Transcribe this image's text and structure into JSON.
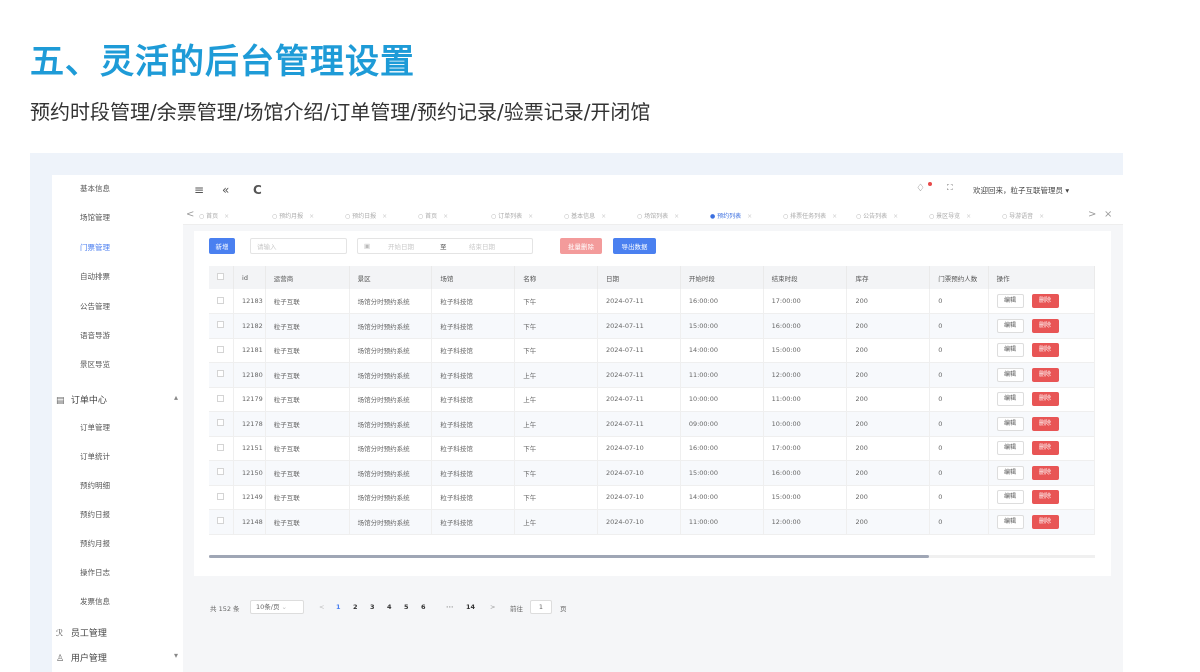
{
  "heading": {
    "title": "五、灵活的后台管理设置",
    "subtitle": "预约时段管理/余票管理/场馆介绍/订单管理/预约记录/验票记录/开闭馆"
  },
  "colors": {
    "accent": "#1e9bd7",
    "primary": "#4a80f0",
    "danger": "#e85555",
    "frame_bg": "#eef3fa"
  },
  "sidebar": {
    "items": [
      "基本信息",
      "场馆管理",
      "门票管理",
      "自动排票",
      "公告管理",
      "语音导游",
      "景区导览"
    ],
    "active_item": "门票管理",
    "order_center": {
      "icon": "order-icon",
      "label": "订单中心",
      "arrow": "▴"
    },
    "order_items": [
      "订单管理",
      "订单统计",
      "预约明细",
      "预约日报",
      "预约月报",
      "操作日志",
      "发票信息"
    ],
    "staff": {
      "icon": "staff-icon",
      "label": "员工管理"
    },
    "users": {
      "icon": "user-icon",
      "label": "用户管理",
      "arrow": "▾"
    }
  },
  "topbar": {
    "menu_icon": "≡",
    "collapse_icon": "«",
    "refresh_icon": "C",
    "bell_icon": "bell-icon",
    "fullscreen_icon": "fullscreen-icon",
    "welcome": "欢迎回来，粒子互联管理员 ▾"
  },
  "tabs": {
    "prev": "<",
    "next": ">",
    "close": "×",
    "items": [
      "首页",
      "预约月报",
      "预约日报",
      "首页",
      "订单列表",
      "基本信息",
      "场馆列表",
      "预约列表",
      "排票任务列表",
      "公告列表",
      "景区导览",
      "导游语音"
    ],
    "active_index": 7
  },
  "toolbar": {
    "add_label": "新增",
    "search_placeholder": "请输入",
    "date_icon": "calendar-icon",
    "start_date_placeholder": "开始日期",
    "date_separator": "至",
    "end_date_placeholder": "结束日期",
    "batch_delete_label": "批量删除",
    "export_label": "导出数据"
  },
  "table": {
    "columns": [
      "",
      "id",
      "运营商",
      "景区",
      "场馆",
      "名称",
      "日期",
      "开始时段",
      "结束时段",
      "库存",
      "门票预约人数",
      "操作"
    ],
    "edit_label": "编辑",
    "delete_label": "删除",
    "rows": [
      [
        "12183",
        "粒子互联",
        "场馆分时预约系统",
        "粒子科技馆",
        "下午",
        "2024-07-11",
        "16:00:00",
        "17:00:00",
        "200",
        "0"
      ],
      [
        "12182",
        "粒子互联",
        "场馆分时预约系统",
        "粒子科技馆",
        "下午",
        "2024-07-11",
        "15:00:00",
        "16:00:00",
        "200",
        "0"
      ],
      [
        "12181",
        "粒子互联",
        "场馆分时预约系统",
        "粒子科技馆",
        "下午",
        "2024-07-11",
        "14:00:00",
        "15:00:00",
        "200",
        "0"
      ],
      [
        "12180",
        "粒子互联",
        "场馆分时预约系统",
        "粒子科技馆",
        "上午",
        "2024-07-11",
        "11:00:00",
        "12:00:00",
        "200",
        "0"
      ],
      [
        "12179",
        "粒子互联",
        "场馆分时预约系统",
        "粒子科技馆",
        "上午",
        "2024-07-11",
        "10:00:00",
        "11:00:00",
        "200",
        "0"
      ],
      [
        "12178",
        "粒子互联",
        "场馆分时预约系统",
        "粒子科技馆",
        "上午",
        "2024-07-11",
        "09:00:00",
        "10:00:00",
        "200",
        "0"
      ],
      [
        "12151",
        "粒子互联",
        "场馆分时预约系统",
        "粒子科技馆",
        "下午",
        "2024-07-10",
        "16:00:00",
        "17:00:00",
        "200",
        "0"
      ],
      [
        "12150",
        "粒子互联",
        "场馆分时预约系统",
        "粒子科技馆",
        "下午",
        "2024-07-10",
        "15:00:00",
        "16:00:00",
        "200",
        "0"
      ],
      [
        "12149",
        "粒子互联",
        "场馆分时预约系统",
        "粒子科技馆",
        "下午",
        "2024-07-10",
        "14:00:00",
        "15:00:00",
        "200",
        "0"
      ],
      [
        "12148",
        "粒子互联",
        "场馆分时预约系统",
        "粒子科技馆",
        "上午",
        "2024-07-10",
        "11:00:00",
        "12:00:00",
        "200",
        "0"
      ]
    ]
  },
  "pagination": {
    "total_label": "共 152 条",
    "page_size": "10条/页",
    "prev": "<",
    "pages": [
      "1",
      "2",
      "3",
      "4",
      "5",
      "6"
    ],
    "ellipsis": "···",
    "last_page": "14",
    "next": ">",
    "goto_label": "前往",
    "goto_value": "1",
    "page_unit": "页",
    "current_page": 1
  }
}
